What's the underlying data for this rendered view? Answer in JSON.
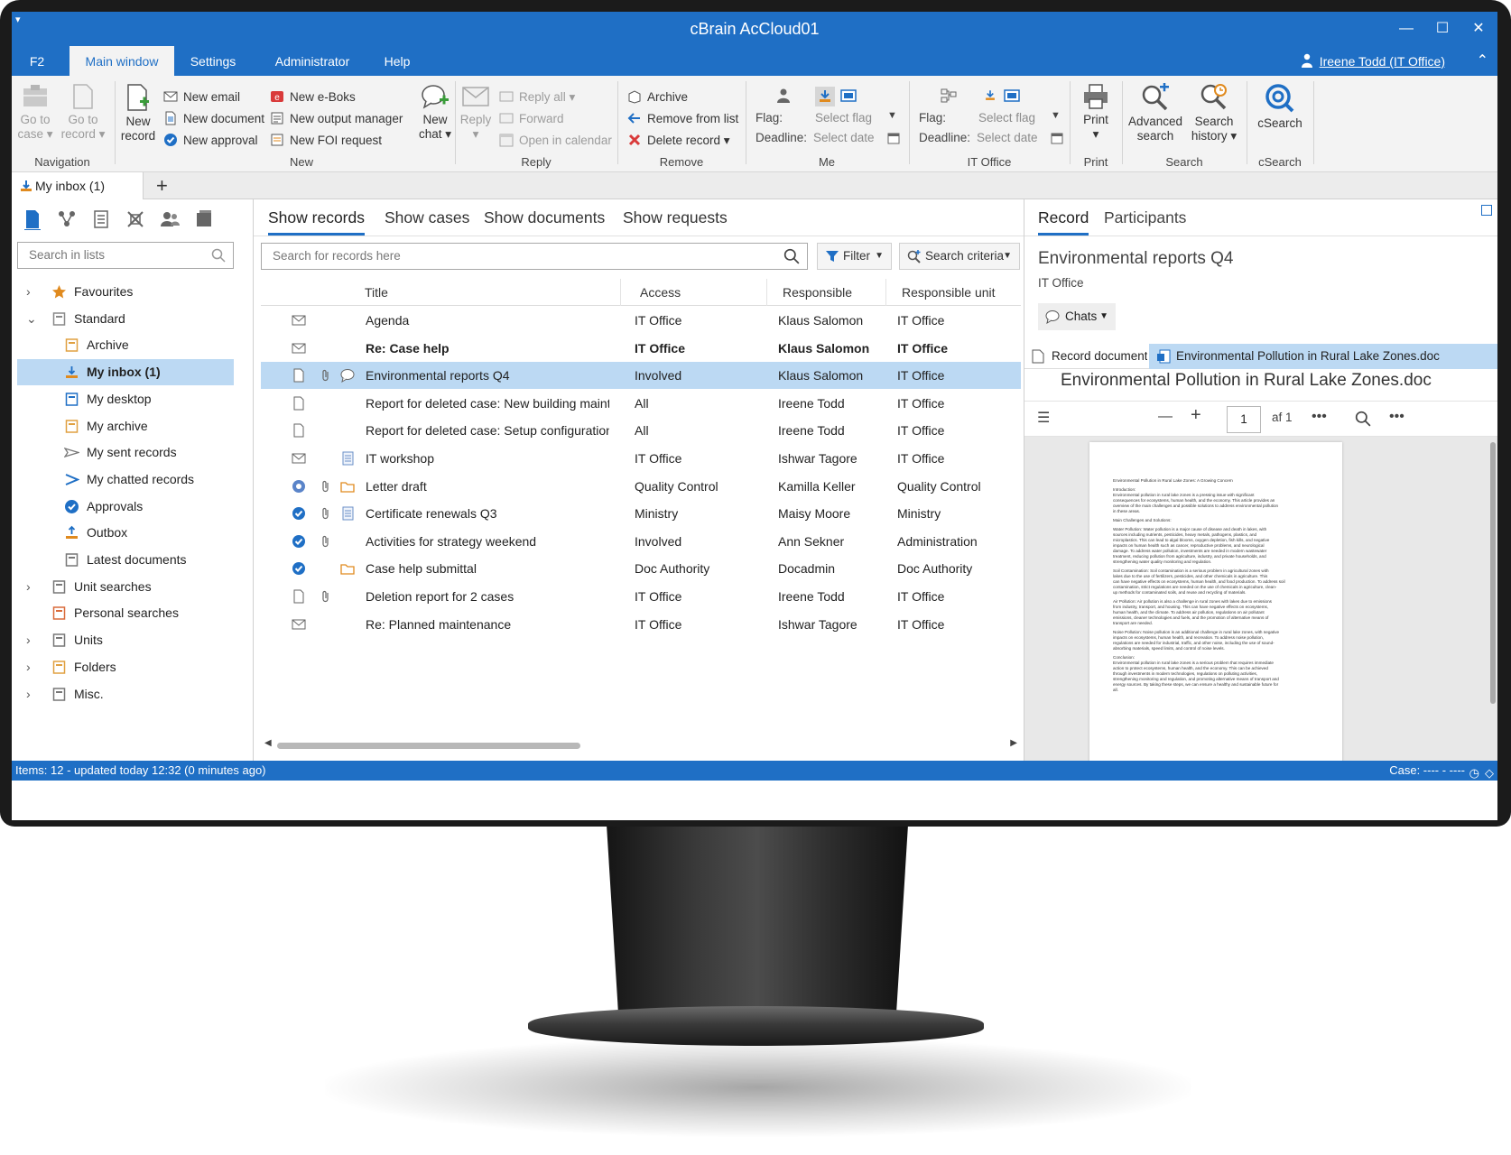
{
  "window": {
    "title": "cBrain AcCloud01"
  },
  "menu": {
    "tabs": [
      "F2",
      "Main window",
      "Settings",
      "Administrator",
      "Help"
    ],
    "user": "Ireene Todd (IT Office)"
  },
  "ribbon": {
    "navigation": {
      "label": "Navigation",
      "go_to_case": [
        "Go to",
        "case"
      ],
      "go_to_record": [
        "Go to",
        "record"
      ]
    },
    "new": {
      "label": "New",
      "new_record": [
        "New",
        "record"
      ],
      "new_email": "New email",
      "new_document": "New document",
      "new_approval": "New approval",
      "new_eboks": "New e-Boks",
      "new_output_manager": "New output manager",
      "new_foi_request": "New FOI request",
      "new_chat": [
        "New",
        "chat"
      ]
    },
    "reply": {
      "label": "Reply",
      "reply": "Reply",
      "reply_all": "Reply all",
      "forward": "Forward",
      "open_in_calendar": "Open in calendar"
    },
    "remove": {
      "label": "Remove",
      "archive": "Archive",
      "remove_from_list": "Remove from list",
      "delete_record": "Delete record"
    },
    "me": {
      "label": "Me",
      "flag": "Flag:",
      "deadline": "Deadline:",
      "select_flag": "Select flag",
      "select_date": "Select date"
    },
    "it_office": {
      "label": "IT Office",
      "flag": "Flag:",
      "deadline": "Deadline:",
      "select_flag": "Select flag",
      "select_date": "Select date"
    },
    "print": {
      "label": "Print",
      "print": "Print"
    },
    "search": {
      "label": "Search",
      "advanced": [
        "Advanced",
        "search"
      ],
      "history": [
        "Search",
        "history"
      ]
    },
    "csearch": {
      "label": "cSearch",
      "csearch": "cSearch"
    }
  },
  "doc_tab": {
    "label": "My inbox (1)"
  },
  "left": {
    "search_placeholder": "Search in lists",
    "tree": [
      {
        "label": "Favourites",
        "chev": "›",
        "icon": "star-icon"
      },
      {
        "label": "Standard",
        "chev": "⌄",
        "icon": "folder-icon"
      },
      {
        "label": "Archive",
        "icon": "archive-icon"
      },
      {
        "label": "My inbox (1)",
        "icon": "inbox-icon"
      },
      {
        "label": "My desktop",
        "icon": "desktop-icon"
      },
      {
        "label": "My archive",
        "icon": "my-archive-icon"
      },
      {
        "label": "My sent records",
        "icon": "sent-icon"
      },
      {
        "label": "My chatted records",
        "icon": "chatted-icon"
      },
      {
        "label": "Approvals",
        "icon": "approval-icon"
      },
      {
        "label": "Outbox",
        "icon": "outbox-icon"
      },
      {
        "label": "Latest documents",
        "icon": "document-icon"
      },
      {
        "label": "Unit searches",
        "chev": "›",
        "icon": "unit-search-icon"
      },
      {
        "label": "Personal searches",
        "icon": "personal-search-icon"
      },
      {
        "label": "Units",
        "chev": "›",
        "icon": "units-icon"
      },
      {
        "label": "Folders",
        "chev": "›",
        "icon": "folders-icon"
      },
      {
        "label": "Misc.",
        "chev": "›",
        "icon": "misc-icon"
      }
    ]
  },
  "center": {
    "tabs": [
      "Show records",
      "Show cases",
      "Show documents",
      "Show requests"
    ],
    "search_placeholder": "Search for records here",
    "filter": "Filter",
    "search_criteria": "Search criteria",
    "columns": [
      "Title",
      "Access",
      "Responsible",
      "Responsible unit"
    ],
    "rows": [
      {
        "title": "Agenda",
        "access": "IT Office",
        "responsible": "Klaus Salomon",
        "unit": "IT Office",
        "icons": [
          "email"
        ]
      },
      {
        "title": "Re: Case help",
        "access": "IT Office",
        "responsible": "Klaus Salomon",
        "unit": "IT Office",
        "icons": [
          "email"
        ]
      },
      {
        "title": "Environmental reports Q4",
        "access": "Involved",
        "responsible": "Klaus Salomon",
        "unit": "IT Office",
        "icons": [
          "document",
          "attachment",
          "chat"
        ]
      },
      {
        "title": "Report for deleted case: New building mainte...",
        "access": "All",
        "responsible": "Ireene Todd",
        "unit": "IT Office",
        "icons": [
          "document"
        ]
      },
      {
        "title": "Report for deleted case: Setup configurations...",
        "access": "All",
        "responsible": "Ireene Todd",
        "unit": "IT Office",
        "icons": [
          "document"
        ]
      },
      {
        "title": "IT workshop",
        "access": "IT Office",
        "responsible": "Ishwar Tagore",
        "unit": "IT Office",
        "icons": [
          "email",
          "",
          "list"
        ]
      },
      {
        "title": "Letter draft",
        "access": "Quality Control",
        "responsible": "Kamilla Keller",
        "unit": "Quality Control",
        "icons": [
          "approval-pending",
          "attachment",
          "folder"
        ]
      },
      {
        "title": "Certificate renewals Q3",
        "access": "Ministry",
        "responsible": "Maisy Moore",
        "unit": "Ministry",
        "icons": [
          "approval",
          "attachment",
          "list"
        ]
      },
      {
        "title": "Activities for strategy weekend",
        "access": "Involved",
        "responsible": "Ann Sekner",
        "unit": "Administration",
        "icons": [
          "approval",
          "attachment"
        ]
      },
      {
        "title": "Case help submittal",
        "access": "Doc Authority",
        "responsible": "Docadmin",
        "unit": "Doc Authority",
        "icons": [
          "approval",
          "",
          "folder"
        ]
      },
      {
        "title": "Deletion report for 2 cases",
        "access": "IT Office",
        "responsible": "Ireene Todd",
        "unit": "IT Office",
        "icons": [
          "document",
          "attachment"
        ]
      },
      {
        "title": "Re: Planned maintenance",
        "access": "IT Office",
        "responsible": "Ishwar Tagore",
        "unit": "IT Office",
        "icons": [
          "email"
        ]
      }
    ]
  },
  "right": {
    "tabs": [
      "Record",
      "Participants"
    ],
    "title": "Environmental reports Q4",
    "subtitle": "IT Office",
    "chats": "Chats",
    "doc_tabs": [
      "Record document",
      "Environmental Pollution in Rural Lake Zones.doc"
    ],
    "doc_name": "Environmental Pollution in Rural Lake Zones.doc",
    "page": "1",
    "page_of": "af 1",
    "pdf_lines": [
      "Environmental Pollution in Rural Lake Zones: A Growing Concern",
      "",
      "Introduction:",
      "Environmental pollution in rural lake zones is a pressing issue with significant",
      "consequences for ecosystems, human health, and the economy. This article provides an",
      "overview of the main challenges and possible solutions to address environmental pollution",
      "in these areas.",
      "",
      "Main Challenges and Solutions:",
      "",
      "Water Pollution: Water pollution is a major cause of disease and death in lakes, with",
      "sources including nutrients, pesticides, heavy metals, pathogens, plastics, and",
      "microplastics. This can lead to algal blooms, oxygen depletion, fish kills, and negative",
      "impacts on human health such as cancer, reproductive problems, and neurological",
      "damage. To address water pollution, investments are needed in modern wastewater",
      "treatment, reducing pollution from agriculture, industry, and private households, and",
      "strengthening water quality monitoring and regulation.",
      "",
      "Soil Contamination: Soil contamination is a serious problem in agricultural zones with",
      "lakes due to the use of fertilizers, pesticides, and other chemicals in agriculture. This",
      "can have negative effects on ecosystems, human health, and food production. To address soil",
      "contamination, strict regulations are needed on the use of chemicals in agriculture, clean-",
      "up methods for contaminated soils, and reuse and recycling of materials.",
      "",
      "Air Pollution: Air pollution is also a challenge in rural zones with lakes due to emissions",
      "from industry, transport, and housing. This can have negative effects on ecosystems,",
      "human health, and the climate. To address air pollution, regulations on air pollutant",
      "emissions, cleaner technologies and fuels, and the promotion of alternative means of",
      "transport are needed.",
      "",
      "Noise Pollution: Noise pollution is an additional challenge in rural lake zones, with negative",
      "impacts on ecosystems, human health, and recreation. To address noise pollution,",
      "regulations are needed for industrial, traffic, and other noise, including the use of sound-",
      "absorbing materials, speed limits, and control of noise levels.",
      "",
      "Conclusion:",
      "Environmental pollution in rural lake zones is a serious problem that requires immediate",
      "action to protect ecosystems, human health, and the economy. This can be achieved",
      "through investments in modern technologies, regulations on polluting activities,",
      "strengthening monitoring and regulation, and promoting alternative means of transport and",
      "energy sources. By taking these steps, we can ensure a healthy and sustainable future for",
      "all."
    ]
  },
  "status": {
    "left": "Items: 12 - updated today 12:32 (0 minutes ago)",
    "right": "Case: ---- - ----"
  },
  "colors": {
    "accent": "#1f6fc5",
    "selection": "#bcd9f3"
  }
}
